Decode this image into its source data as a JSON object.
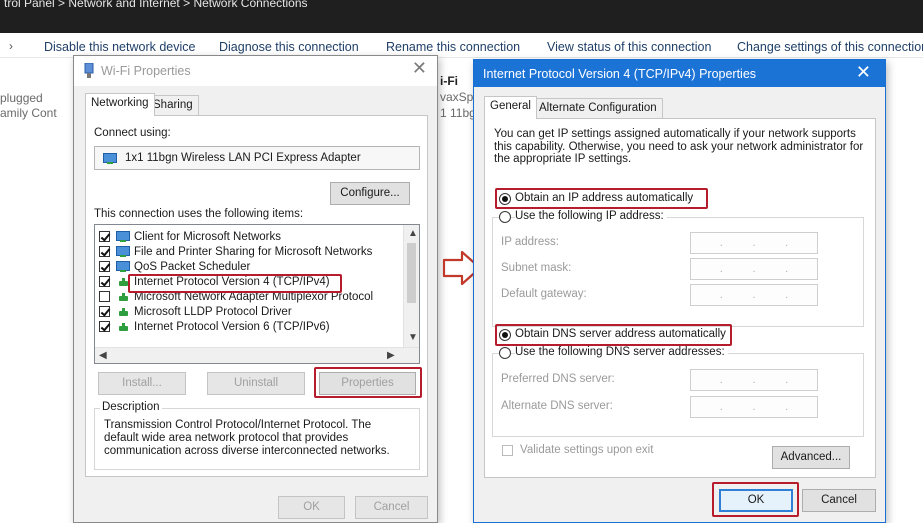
{
  "explorer": {
    "breadcrumb": "trol Panel  >  Network and Internet  >  Network Connections",
    "commands": [
      "Disable this network device",
      "Diagnose this connection",
      "Rename this connection",
      "View status of this connection",
      "Change settings of this connection"
    ],
    "left_status_1": "plugged",
    "left_status_2": "amily Cont",
    "middle_name": "i-Fi",
    "middle_line2": "vaxSp",
    "middle_line3": "1 11bg"
  },
  "wifi_dialog": {
    "title": "Wi-Fi Properties",
    "tabs": [
      "Networking",
      "Sharing"
    ],
    "connect_using_label": "Connect using:",
    "adapter_name": "1x1 11bgn Wireless LAN PCI Express Adapter",
    "configure_label": "Configure...",
    "items_label": "This connection uses the following items:",
    "items": [
      {
        "label": "Client for Microsoft Networks",
        "checked": true,
        "icon": "blue"
      },
      {
        "label": "File and Printer Sharing for Microsoft Networks",
        "checked": true,
        "icon": "blue"
      },
      {
        "label": "QoS Packet Scheduler",
        "checked": true,
        "icon": "blue"
      },
      {
        "label": "Internet Protocol Version 4 (TCP/IPv4)",
        "checked": true,
        "icon": "green"
      },
      {
        "label": "Microsoft Network Adapter Multiplexor Protocol",
        "checked": false,
        "icon": "green"
      },
      {
        "label": "Microsoft LLDP Protocol Driver",
        "checked": true,
        "icon": "green"
      },
      {
        "label": "Internet Protocol Version 6 (TCP/IPv6)",
        "checked": true,
        "icon": "green"
      }
    ],
    "install_label": "Install...",
    "uninstall_label": "Uninstall",
    "properties_label": "Properties",
    "description_heading": "Description",
    "description_text": "Transmission Control Protocol/Internet Protocol. The default wide area network protocol that provides communication across diverse interconnected networks.",
    "ok_label": "OK",
    "cancel_label": "Cancel"
  },
  "ipv4_dialog": {
    "title": "Internet Protocol Version 4 (TCP/IPv4) Properties",
    "tabs": [
      "General",
      "Alternate Configuration"
    ],
    "intro": "You can get IP settings assigned automatically if your network supports this capability. Otherwise, you need to ask your network administrator for the appropriate IP settings.",
    "obtain_ip_auto": "Obtain an IP address automatically",
    "use_following_ip": "Use the following IP address:",
    "ip_address_label": "IP address:",
    "subnet_mask_label": "Subnet mask:",
    "default_gateway_label": "Default gateway:",
    "obtain_dns_auto": "Obtain DNS server address automatically",
    "use_following_dns": "Use the following DNS server addresses:",
    "preferred_dns_label": "Preferred DNS server:",
    "alternate_dns_label": "Alternate DNS server:",
    "ip_placeholder": ".   .   .",
    "validate_label": "Validate settings upon exit",
    "advanced_label": "Advanced...",
    "ok_label": "OK",
    "cancel_label": "Cancel",
    "ip_auto_selected": true,
    "dns_auto_selected": true
  },
  "colors": {
    "highlight_box": "#b71c2c",
    "ipv4_titlebar": "#1c73d6",
    "arrow": "#c0392b"
  }
}
